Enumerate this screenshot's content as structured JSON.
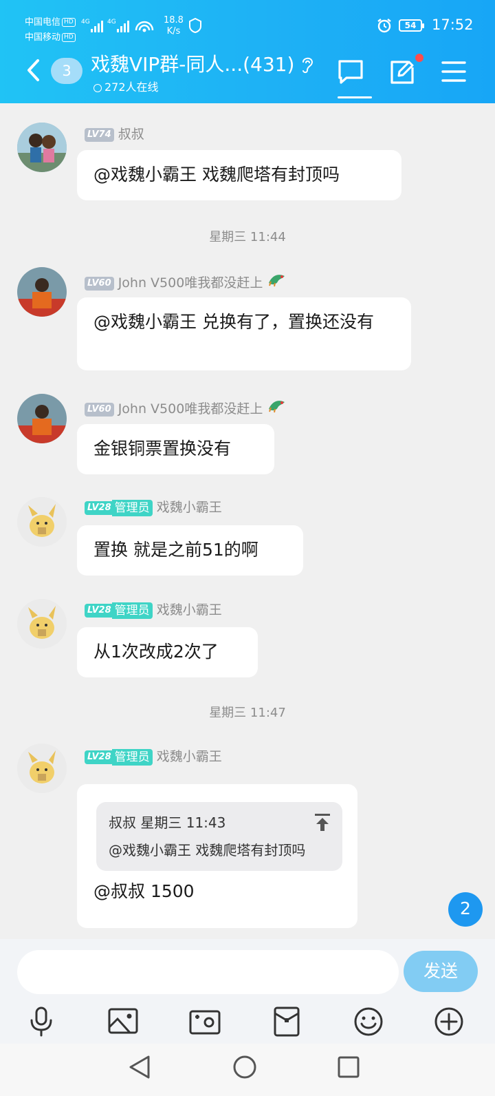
{
  "status_bar": {
    "carrier1": "中国电信",
    "carrier2": "中国移动",
    "hd": "HD",
    "net1": "4G",
    "net2": "4G",
    "speed_value": "18.8",
    "speed_unit": "K/s",
    "battery": "54",
    "time": "17:52"
  },
  "header": {
    "unread_count": "3",
    "title": "戏魏VIP群-同人...(431)",
    "online": "272人在线",
    "icons": [
      "back-arrow-icon",
      "ear-icon",
      "chat-icon",
      "edit-icon",
      "menu-icon"
    ]
  },
  "messages": [
    {
      "level": "LV74",
      "sender": "叔叔",
      "text": "@戏魏小霸王 戏魏爬塔有封顶吗"
    },
    {
      "level": "LV60",
      "sender": "John V500唯我都没赶上",
      "text": "@戏魏小霸王 兑换有了，置换还没有"
    },
    {
      "level": "LV60",
      "sender": "John V500唯我都没赶上",
      "text": "金银铜票置换没有"
    },
    {
      "level": "LV28",
      "role": "管理员",
      "sender": "戏魏小霸王",
      "text": "置换 就是之前51的啊"
    },
    {
      "level": "LV28",
      "role": "管理员",
      "sender": "戏魏小霸王",
      "text": "从1次改成2次了"
    },
    {
      "level": "LV28",
      "role": "管理员",
      "sender": "戏魏小霸王",
      "quote_header": "叔叔 星期三 11:43",
      "quote_text": "@戏魏小霸王 戏魏爬塔有封顶吗",
      "text": "@叔叔 1500"
    }
  ],
  "timestamps": [
    "星期三 11:44",
    "星期三 11:47"
  ],
  "new_message_badge": "2",
  "input": {
    "placeholder": "",
    "send_label": "发送"
  },
  "toolbar_icons": [
    "microphone-icon",
    "image-icon",
    "camera-icon",
    "red-packet-icon",
    "emoji-icon",
    "plus-icon"
  ],
  "nav_icons": [
    "back-nav-icon",
    "home-nav-icon",
    "recents-nav-icon"
  ],
  "colors": {
    "header": "#1eb1f5",
    "send": "#82ccf3",
    "badge": "#1e98f0",
    "admin_tag": "#3fd4c6",
    "level_tag": "#b7bfcb"
  }
}
